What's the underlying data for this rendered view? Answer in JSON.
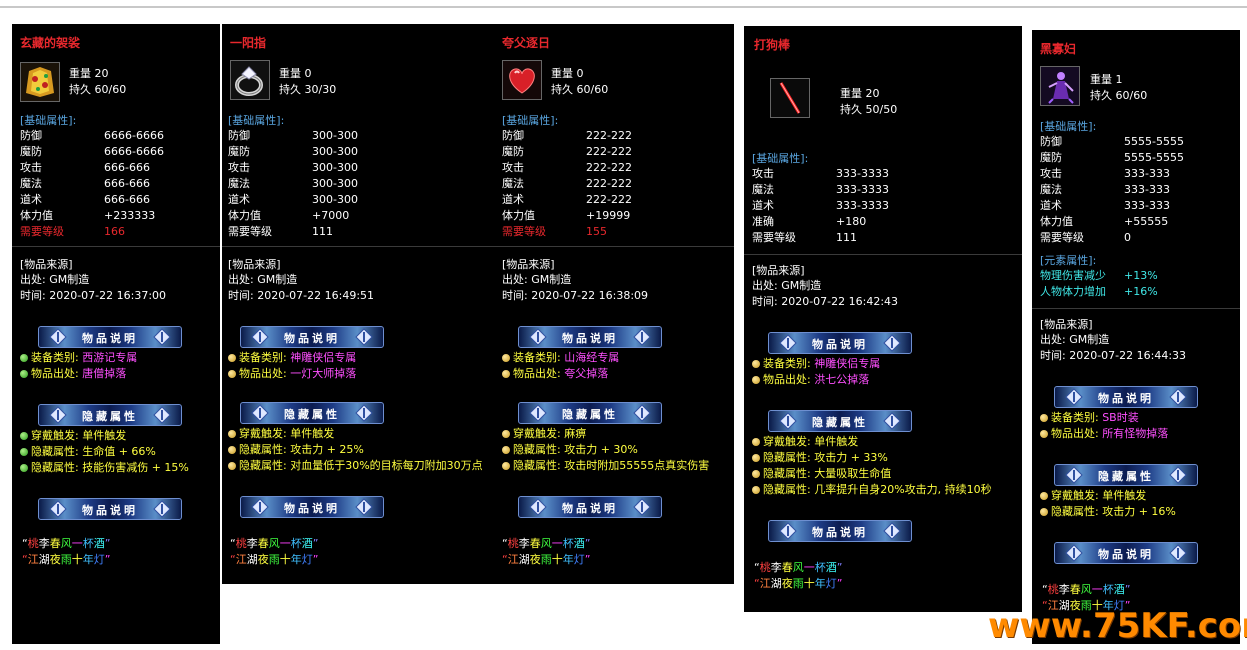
{
  "colors": {
    "accent_red": "#e8282d",
    "section_blue": "#5aa6e0",
    "purple": "#ff50ff",
    "green": "#3cff5a",
    "watermark": "#ff8a00"
  },
  "banners": {
    "explain": "物品说明",
    "hidden": "隐藏属性"
  },
  "labels": {
    "weight": "重量",
    "durability": "持久",
    "base_attr": "[基础属性]:",
    "source": "[物品来源]",
    "elem_attr": "[元素属性]:"
  },
  "poem": {
    "line1": [
      {
        "t": "“",
        "c": "#ffffff"
      },
      {
        "t": "桃",
        "c": "#ff4040"
      },
      {
        "t": "李",
        "c": "#ffffff"
      },
      {
        "t": "春",
        "c": "#ffff40"
      },
      {
        "t": "风",
        "c": "#40ff40"
      },
      {
        "t": "一",
        "c": "#ff40ff"
      },
      {
        "t": "杯",
        "c": "#40c0ff"
      },
      {
        "t": "酒",
        "c": "#40ffff"
      },
      {
        "t": "”",
        "c": "#8080ff"
      }
    ],
    "line2": [
      {
        "t": "“",
        "c": "#ff4040"
      },
      {
        "t": "江",
        "c": "#ff8040"
      },
      {
        "t": "湖",
        "c": "#ffffff"
      },
      {
        "t": "夜",
        "c": "#ffff40"
      },
      {
        "t": "雨",
        "c": "#40ff40"
      },
      {
        "t": "十",
        "c": "#ffff40"
      },
      {
        "t": "年",
        "c": "#40c0ff"
      },
      {
        "t": "灯",
        "c": "#4080ff"
      },
      {
        "t": "”",
        "c": "#ff40ff"
      }
    ]
  },
  "watermark": "www.75KF.com",
  "items": [
    {
      "name": "玄藏的袈裟",
      "icon": "robe-icon",
      "weight": "20",
      "durability": "60/60",
      "attrs": [
        [
          "防御",
          "6666-6666"
        ],
        [
          "魔防",
          "6666-6666"
        ],
        [
          "攻击",
          "666-666"
        ],
        [
          "魔法",
          "666-666"
        ],
        [
          "道术",
          "666-666"
        ],
        [
          "体力值",
          "+233333"
        ]
      ],
      "req": [
        "需要等级",
        "166"
      ],
      "source_from": "出处: GM制造",
      "source_time": "时间: 2020-07-22 16:37:00",
      "explain": [
        [
          "装备类别: ",
          "西游记专属"
        ],
        [
          "物品出处: ",
          "唐僧掉落"
        ]
      ],
      "hidden": [
        [
          "穿戴触发: 单件触发",
          ""
        ],
        [
          "隐藏属性: 生命值 + 66%",
          ""
        ],
        [
          "隐藏属性: 技能伤害减伤 + 15%",
          ""
        ]
      ]
    },
    {
      "name": "一阳指",
      "icon": "ring-icon",
      "weight": "0",
      "durability": "30/30",
      "attrs": [
        [
          "防御",
          "300-300"
        ],
        [
          "魔防",
          "300-300"
        ],
        [
          "攻击",
          "300-300"
        ],
        [
          "魔法",
          "300-300"
        ],
        [
          "道术",
          "300-300"
        ],
        [
          "体力值",
          "+7000"
        ],
        [
          "需要等级",
          "111"
        ]
      ],
      "req": null,
      "source_from": "出处: GM制造",
      "source_time": "时间: 2020-07-22 16:49:51",
      "explain": [
        [
          "装备类别: ",
          "神雕侠侣专属"
        ],
        [
          "物品出处: ",
          "一灯大师掉落"
        ]
      ],
      "hidden": [
        [
          "穿戴触发: 单件触发",
          ""
        ],
        [
          "隐藏属性: 攻击力 + 25%",
          ""
        ],
        [
          "隐藏属性: 对血量低于30%的目标每刀附加30万点",
          ""
        ]
      ]
    },
    {
      "name": "夸父逐日",
      "icon": "heart-icon",
      "weight": "0",
      "durability": "60/60",
      "attrs": [
        [
          "防御",
          "222-222"
        ],
        [
          "魔防",
          "222-222"
        ],
        [
          "攻击",
          "222-222"
        ],
        [
          "魔法",
          "222-222"
        ],
        [
          "道术",
          "222-222"
        ],
        [
          "体力值",
          "+19999"
        ]
      ],
      "req": [
        "需要等级",
        "155"
      ],
      "source_from": "出处: GM制造",
      "source_time": "时间: 2020-07-22 16:38:09",
      "explain": [
        [
          "装备类别: ",
          "山海经专属"
        ],
        [
          "物品出处: ",
          "夸父掉落"
        ]
      ],
      "hidden": [
        [
          "穿戴触发: 麻痹",
          ""
        ],
        [
          "隐藏属性: 攻击力 + 30%",
          ""
        ],
        [
          "隐藏属性: 攻击时附加55555点真实伤害",
          ""
        ]
      ]
    },
    {
      "name": "打狗棒",
      "icon": "staff-icon",
      "weight": "20",
      "durability": "50/50",
      "attrs": [
        [
          "攻击",
          "333-3333"
        ],
        [
          "魔法",
          "333-3333"
        ],
        [
          "道术",
          "333-3333"
        ],
        [
          "准确",
          "+180"
        ],
        [
          "需要等级",
          "111"
        ]
      ],
      "req": null,
      "source_from": "出处: GM制造",
      "source_time": "时间: 2020-07-22 16:42:43",
      "explain": [
        [
          "装备类别: ",
          "神雕侠侣专属"
        ],
        [
          "物品出处: ",
          "洪七公掉落"
        ]
      ],
      "hidden": [
        [
          "穿戴触发: 单件触发",
          ""
        ],
        [
          "隐藏属性: 攻击力 + 33%",
          ""
        ],
        [
          "隐藏属性: 大量吸取生命值",
          ""
        ],
        [
          "隐藏属性: 几率提升自身20%攻击力, 持续10秒",
          ""
        ]
      ]
    },
    {
      "name": "黑寡妇",
      "icon": "widow-icon",
      "weight": "1",
      "durability": "60/60",
      "attrs": [
        [
          "防御",
          "5555-5555"
        ],
        [
          "魔防",
          "5555-5555"
        ],
        [
          "攻击",
          "333-333"
        ],
        [
          "魔法",
          "333-333"
        ],
        [
          "道术",
          "333-333"
        ],
        [
          "体力值",
          "+55555"
        ],
        [
          "需要等级",
          "0"
        ]
      ],
      "elem": [
        [
          "物理伤害减少",
          "+13%"
        ],
        [
          "人物体力增加",
          "+16%"
        ]
      ],
      "source_from": "出处: GM制造",
      "source_time": "时间: 2020-07-22 16:44:33",
      "explain": [
        [
          "装备类别: ",
          "SB时装"
        ],
        [
          "物品出处: ",
          "所有怪物掉落"
        ]
      ],
      "hidden": [
        [
          "穿戴触发: 单件触发",
          ""
        ],
        [
          "隐藏属性: 攻击力 + 16%",
          ""
        ]
      ]
    }
  ]
}
